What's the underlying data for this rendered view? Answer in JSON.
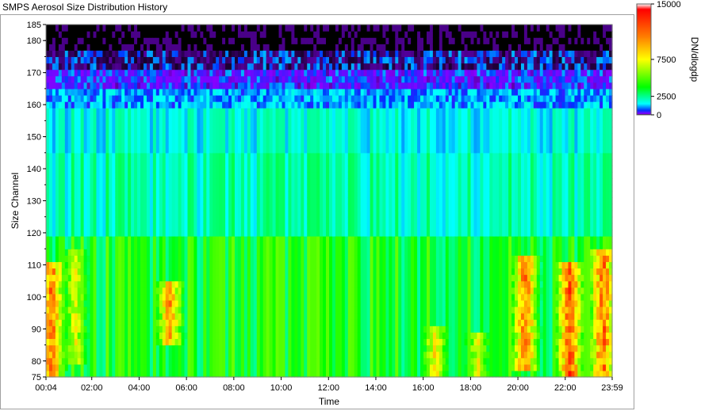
{
  "window": {
    "title": "SMPS Aerosol Size Distribution History"
  },
  "chart_data": {
    "type": "heatmap",
    "title": "SMPS Aerosol Size Distribution History",
    "xlabel": "Time",
    "ylabel": "Size Channel",
    "x_ticks": [
      "00:04",
      "02:00",
      "04:00",
      "06:00",
      "08:00",
      "10:00",
      "12:00",
      "14:00",
      "16:00",
      "18:00",
      "20:00",
      "22:00",
      "23:59"
    ],
    "x_tick_hours": [
      0.0667,
      2,
      4,
      6,
      8,
      10,
      12,
      14,
      16,
      18,
      20,
      22,
      23.983
    ],
    "xlim_hours": [
      0.0667,
      23.983
    ],
    "y_ticks": [
      75,
      80,
      90,
      100,
      110,
      120,
      130,
      140,
      150,
      160,
      170,
      180,
      185
    ],
    "ylim": [
      75,
      185
    ],
    "colorbar": {
      "label": "DN/dlogdp",
      "ticks": [
        15000,
        7500,
        2500,
        0
      ],
      "tick_labels": [
        "15000",
        "7500",
        "2500",
        "0"
      ],
      "range": [
        0,
        15000
      ]
    },
    "colormap": [
      "#000000",
      "#8800ff",
      "#0030ff",
      "#00ffff",
      "#00ff00",
      "#ffff00",
      "#ff8000",
      "#ff0000",
      "#ffffff"
    ],
    "grid": false,
    "legend": "right",
    "approx_profile": [
      {
        "size_range": [
          175,
          185
        ],
        "value": 0,
        "desc": "black/purple band"
      },
      {
        "size_range": [
          165,
          175
        ],
        "value": 100
      },
      {
        "size_range": [
          120,
          165
        ],
        "value": 1800
      },
      {
        "size_range": [
          75,
          120
        ],
        "value": 4500
      }
    ],
    "hotspots": [
      {
        "hour": 0.3,
        "size_range": [
          75,
          110
        ],
        "value": 12000
      },
      {
        "hour": 1.3,
        "size_range": [
          80,
          115
        ],
        "value": 8000
      },
      {
        "hour": 5.3,
        "size_range": [
          85,
          105
        ],
        "value": 11000
      },
      {
        "hour": 16.5,
        "size_range": [
          75,
          90
        ],
        "value": 9000
      },
      {
        "hour": 18.3,
        "size_range": [
          75,
          88
        ],
        "value": 8000
      },
      {
        "hour": 20.3,
        "size_range": [
          78,
          112
        ],
        "value": 12000
      },
      {
        "hour": 22.2,
        "size_range": [
          75,
          110
        ],
        "value": 13000
      },
      {
        "hour": 23.6,
        "size_range": [
          75,
          115
        ],
        "value": 12500
      }
    ]
  }
}
